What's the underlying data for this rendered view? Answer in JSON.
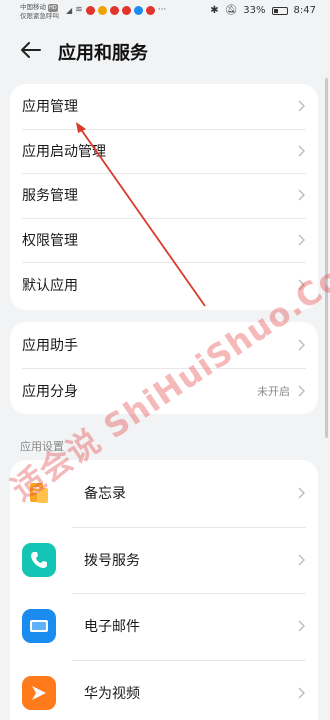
{
  "status_bar": {
    "carrier_line1": "中国移动",
    "carrier_badge": "HD",
    "carrier_line2": "仅限紧急呼叫",
    "battery": "33%",
    "time": "8:47"
  },
  "header": {
    "back_icon": "arrow-left-icon",
    "title": "应用和服务"
  },
  "group1": {
    "items": [
      {
        "label": "应用管理"
      },
      {
        "label": "应用启动管理"
      },
      {
        "label": "服务管理"
      },
      {
        "label": "权限管理"
      },
      {
        "label": "默认应用"
      }
    ]
  },
  "group2": {
    "items": [
      {
        "label": "应用助手",
        "value": ""
      },
      {
        "label": "应用分身",
        "value": "未开启"
      }
    ]
  },
  "section_title": "应用设置",
  "apps": [
    {
      "label": "备忘录",
      "icon": "memo-icon",
      "color": "#f6a623"
    },
    {
      "label": "拨号服务",
      "icon": "phone-icon",
      "color": "#14c4b4"
    },
    {
      "label": "电子邮件",
      "icon": "mail-icon",
      "color": "#1a8cf0"
    },
    {
      "label": "华为视频",
      "icon": "video-icon",
      "color": "#ff7a1a"
    }
  ],
  "watermark": "适会说 ShiHuiShuo.Com",
  "colors": {
    "background": "#f1f3f5",
    "card": "#ffffff",
    "annotation_arrow": "#d93a2b"
  }
}
